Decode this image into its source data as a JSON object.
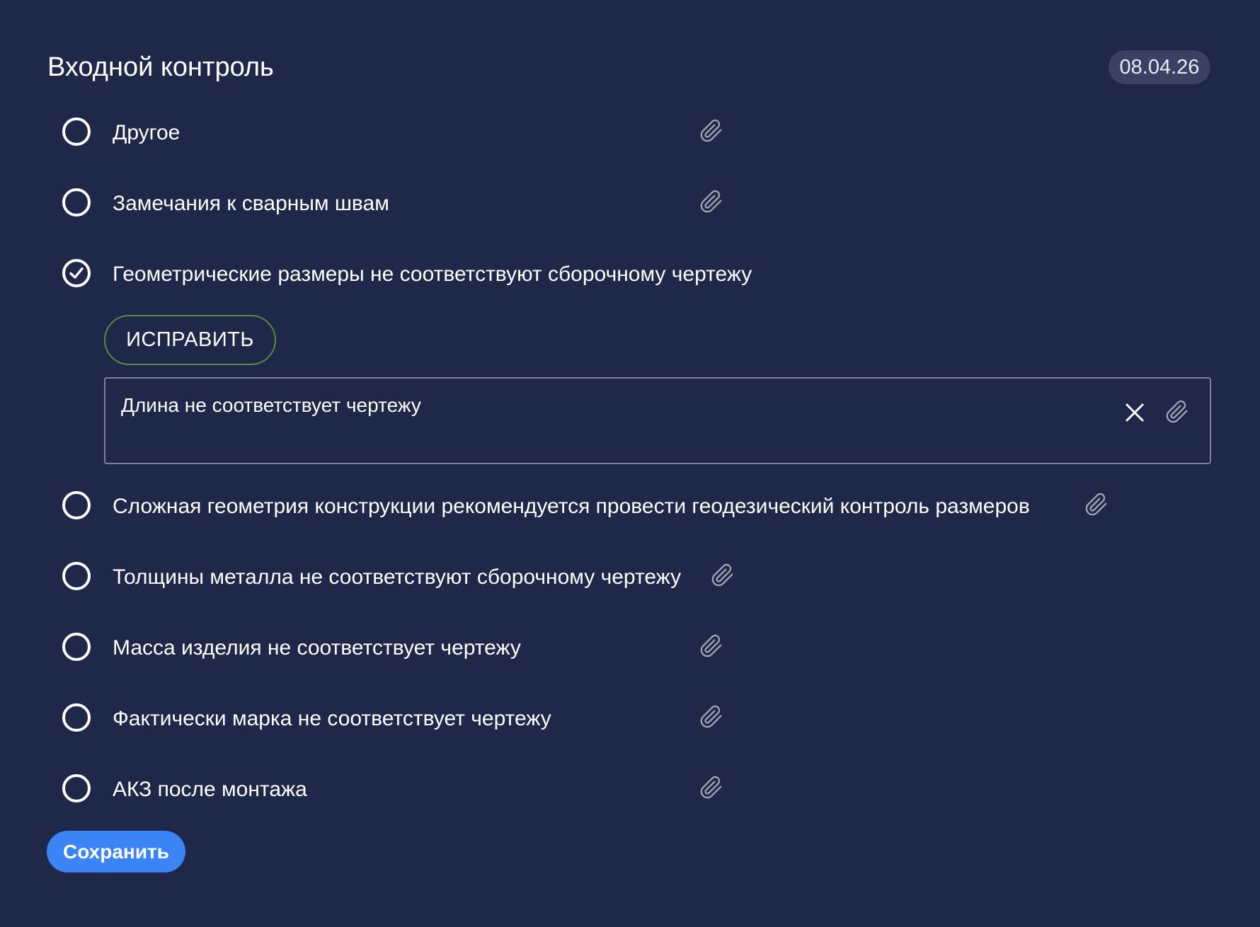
{
  "header": {
    "title": "Входной контроль",
    "date": "08.04.26"
  },
  "items": [
    {
      "label": "Другое",
      "checked": false
    },
    {
      "label": "Замечания к сварным швам",
      "checked": false
    },
    {
      "label": "Геометрические размеры не соответствуют сборочному чертежу",
      "checked": true
    },
    {
      "label": "Сложная геометрия конструкции рекомендуется провести геодезический контроль размеров",
      "checked": false
    },
    {
      "label": "Толщины металла не соответствуют сборочному чертежу",
      "checked": false
    },
    {
      "label": "Масса изделия не соответствует чертежу",
      "checked": false
    },
    {
      "label": "Фактически марка не соответствует чертежу",
      "checked": false
    },
    {
      "label": "АКЗ после монтажа",
      "checked": false
    }
  ],
  "expanded": {
    "fix_label": "ИСПРАВИТЬ",
    "comment": "Длина не соответствует чертежу"
  },
  "footer": {
    "save_label": "Сохранить"
  },
  "icons": {
    "radio_unchecked": "radio-unchecked-icon",
    "radio_checked": "radio-checked-icon",
    "attachment": "paperclip-icon",
    "close": "close-icon"
  },
  "colors": {
    "background": "#1f2849",
    "badge": "#3a4162",
    "fix_border": "#5b8a3c",
    "primary": "#3a84f5",
    "box_border": "#7d8296",
    "clip": "#a3a7b4"
  }
}
